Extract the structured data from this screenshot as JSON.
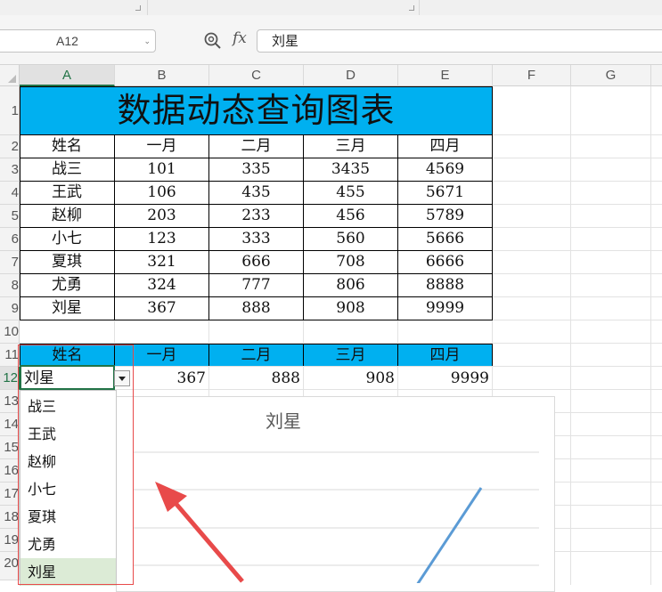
{
  "formula_bar": {
    "name_box": "A12",
    "fx_label": "fx",
    "formula_value": "刘星"
  },
  "columns": [
    "A",
    "B",
    "C",
    "D",
    "E",
    "F",
    "G"
  ],
  "rows": [
    "1",
    "2",
    "3",
    "4",
    "5",
    "6",
    "7",
    "8",
    "9",
    "10",
    "11",
    "12",
    "13",
    "14",
    "15",
    "16",
    "17",
    "18",
    "19",
    "20"
  ],
  "sheet": {
    "title": "数据动态查询图表",
    "headers": [
      "姓名",
      "一月",
      "二月",
      "三月",
      "四月"
    ],
    "data": [
      {
        "name": "战三",
        "m1": "101",
        "m2": "335",
        "m3": "3435",
        "m4": "4569"
      },
      {
        "name": "王武",
        "m1": "106",
        "m2": "435",
        "m3": "455",
        "m4": "5671"
      },
      {
        "name": "赵柳",
        "m1": "203",
        "m2": "233",
        "m3": "456",
        "m4": "5789"
      },
      {
        "name": "小七",
        "m1": "123",
        "m2": "333",
        "m3": "560",
        "m4": "5666"
      },
      {
        "name": "夏琪",
        "m1": "321",
        "m2": "666",
        "m3": "708",
        "m4": "6666"
      },
      {
        "name": "尤勇",
        "m1": "324",
        "m2": "777",
        "m3": "806",
        "m4": "8888"
      },
      {
        "name": "刘星",
        "m1": "367",
        "m2": "888",
        "m3": "908",
        "m4": "9999"
      }
    ],
    "query_headers": [
      "姓名",
      "一月",
      "二月",
      "三月",
      "四月"
    ],
    "query_row": {
      "name": "刘星",
      "m1": "367",
      "m2": "888",
      "m3": "908",
      "m4": "9999"
    }
  },
  "dropdown_options": [
    "战三",
    "王武",
    "赵柳",
    "小七",
    "夏琪",
    "尤勇",
    "刘星"
  ],
  "dropdown_selected": "刘星",
  "chart": {
    "title": "刘星",
    "line_color": "#5b9bd5"
  },
  "colors": {
    "header_fill": "#00b0f0",
    "selection": "#217346",
    "annotation": "#e84a4a"
  }
}
